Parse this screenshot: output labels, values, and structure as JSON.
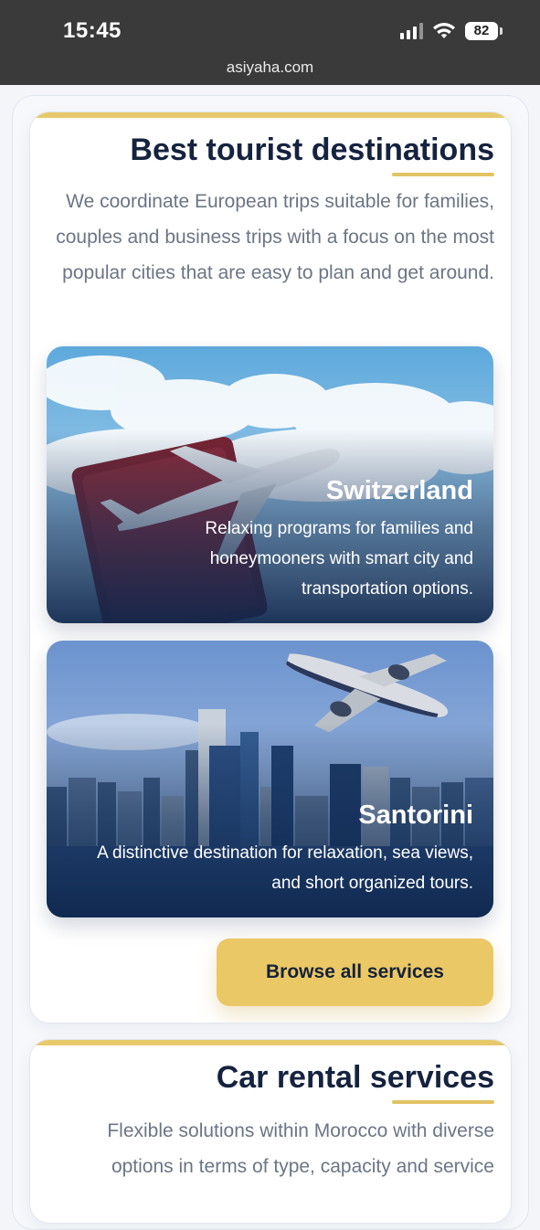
{
  "status_bar": {
    "time": "15:45",
    "battery": "82",
    "url": "asiyaha.com"
  },
  "destinations_section": {
    "title": "Best tourist destinations",
    "description": "We coordinate European trips suitable for families, couples and business trips with a focus on the most popular cities that are easy to plan and get around.",
    "cards": [
      {
        "title": "Switzerland",
        "description": "Relaxing programs for families and honeymooners with smart city and transportation options."
      },
      {
        "title": "Santorini",
        "description": "A distinctive destination for relaxation, sea views, and short organized tours."
      }
    ],
    "button_label": "Browse all services"
  },
  "car_rental_section": {
    "title": "Car rental services",
    "description": "Flexible solutions within Morocco with diverse options in terms of type, capacity and service"
  },
  "colors": {
    "accent": "#e7c86a",
    "navy": "#15233f",
    "text_muted": "#6c7585"
  }
}
